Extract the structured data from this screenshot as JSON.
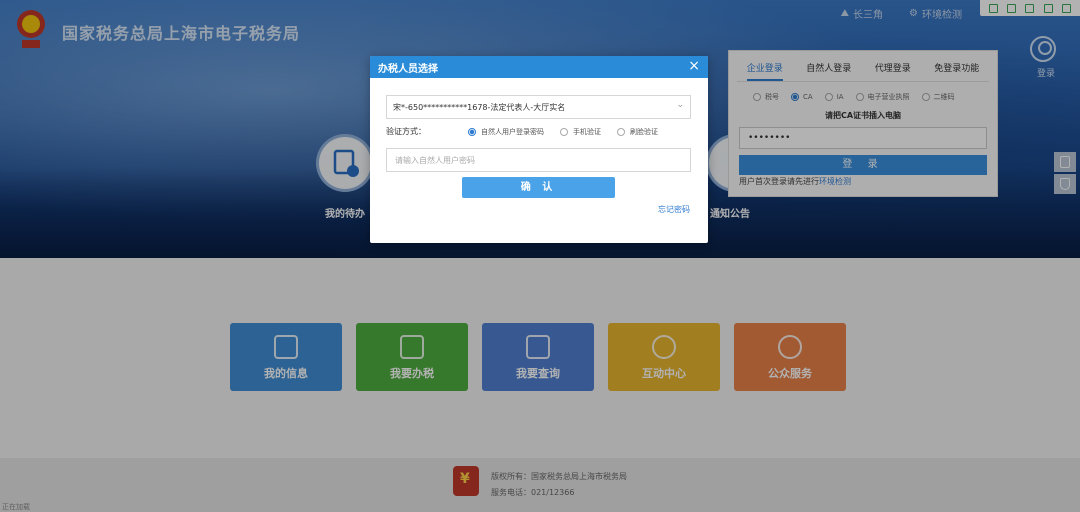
{
  "header": {
    "site_title": "国家税务总局上海市电子税务局",
    "links": [
      "长三角",
      "环境检测"
    ],
    "login_label": "登录"
  },
  "hero": {
    "quick_labels": [
      "我的待办",
      "通知公告"
    ]
  },
  "login_panel": {
    "tabs": [
      "企业登录",
      "自然人登录",
      "代理登录",
      "免登录功能"
    ],
    "active_tab": 0,
    "methods": [
      "税号",
      "CA",
      "IA",
      "电子营业执照",
      "二维码"
    ],
    "selected_method": 1,
    "hint": "请把CA证书插入电脑",
    "pin_value": "••••••••",
    "login_button": "登 录",
    "note_prefix": "用户首次登录请先进行",
    "note_link": "环境检测"
  },
  "tiles": [
    {
      "label": "我的信息",
      "color": "#3f8fd4"
    },
    {
      "label": "我要办税",
      "color": "#4fae3f"
    },
    {
      "label": "我要查询",
      "color": "#4f7fd0"
    },
    {
      "label": "互动中心",
      "color": "#e7b52e"
    },
    {
      "label": "公众服务",
      "color": "#e8824a"
    }
  ],
  "footer": {
    "copyright": "版权所有：国家税务总局上海市税务局",
    "phone": "服务电话：021/12366",
    "corner": "正在加载"
  },
  "modal": {
    "title": "办税人员选择",
    "close": "×",
    "selected_person": "宋*-650***********1678-法定代表人-大厅实名",
    "verify_label": "验证方式：",
    "verify_options": [
      "自然人用户登录密码",
      "手机验证",
      "刷脸验证"
    ],
    "verify_selected": 0,
    "password_placeholder": "请输入自然人用户密码",
    "confirm_button": "确 认",
    "forgot_link": "忘记密码"
  },
  "colors": {
    "modal_header": "#2a8cd8",
    "confirm": "#4aa3e8",
    "login_button": "#3a8fdc",
    "link": "#2e7bd0"
  }
}
